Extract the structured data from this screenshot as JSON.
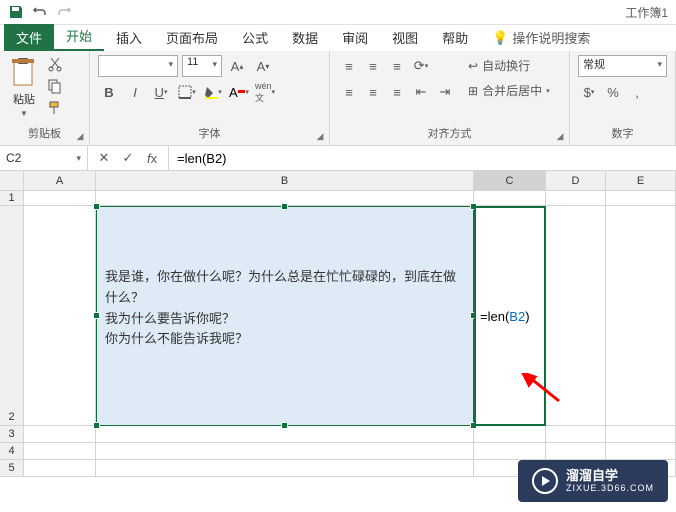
{
  "window": {
    "title": "工作簿1"
  },
  "tabs": {
    "file": "文件",
    "home": "开始",
    "insert": "插入",
    "pagelayout": "页面布局",
    "formulas": "公式",
    "data": "数据",
    "review": "审阅",
    "view": "视图",
    "help": "帮助",
    "search": "操作说明搜索"
  },
  "ribbon": {
    "clipboard": {
      "paste": "粘贴",
      "group": "剪贴板"
    },
    "font": {
      "size": "11",
      "group": "字体"
    },
    "alignment": {
      "wrap": "自动换行",
      "merge": "合并后居中",
      "group": "对齐方式"
    },
    "number": {
      "format": "常规",
      "group": "数字"
    }
  },
  "formula_bar": {
    "cell_ref": "C2",
    "formula": "=len(B2)"
  },
  "columns": {
    "A": "A",
    "B": "B",
    "C": "C",
    "D": "D",
    "E": "E"
  },
  "rows": {
    "1": "1",
    "2": "2",
    "3": "3",
    "4": "4",
    "5": "5"
  },
  "cells": {
    "B2": "我是谁，你在做什么呢？为什么总是在忙忙碌碌的，到底在做什么？\n我为什么要告诉你呢？\n你为什么不能告诉我呢？",
    "C2_prefix": "=len(",
    "C2_ref": "B2",
    "C2_suffix": ")"
  },
  "watermark": {
    "zh": "溜溜自学",
    "en": "ZIXUE.3D66.COM"
  }
}
